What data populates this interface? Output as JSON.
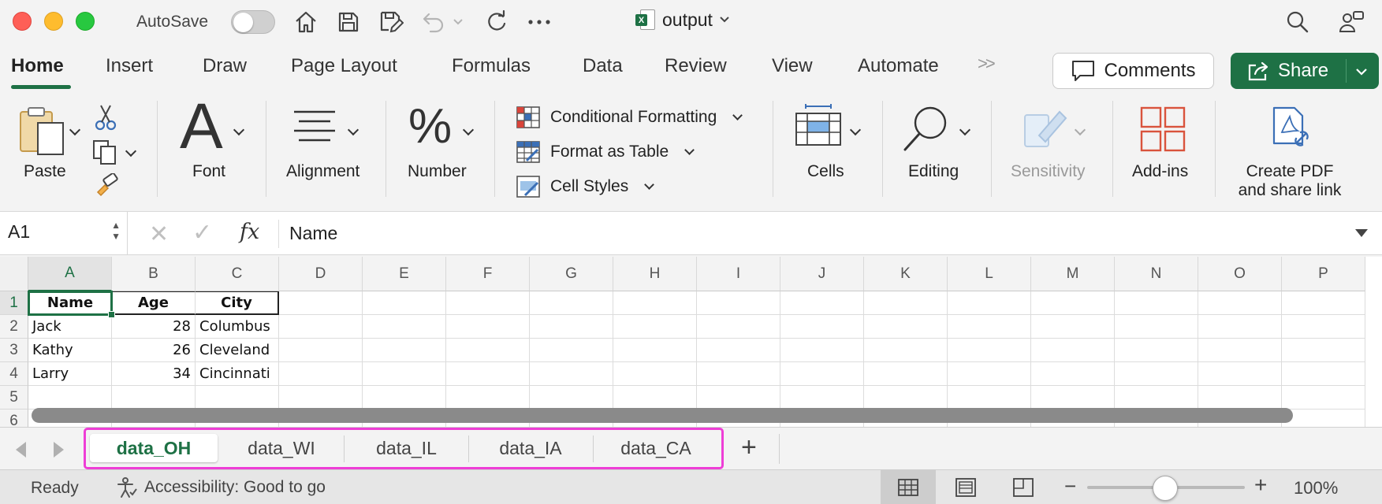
{
  "titlebar": {
    "autosave_label": "AutoSave",
    "autosave_on": false,
    "document_name": "output",
    "icons": [
      "home-icon",
      "save-icon",
      "save-as-icon",
      "undo-icon",
      "redo-icon",
      "more-icon",
      "search-icon",
      "share-people-icon"
    ]
  },
  "ribbon_tabs": {
    "items": [
      {
        "label": "Home",
        "active": true
      },
      {
        "label": "Insert"
      },
      {
        "label": "Draw"
      },
      {
        "label": "Page Layout"
      },
      {
        "label": "Formulas"
      },
      {
        "label": "Data"
      },
      {
        "label": "Review"
      },
      {
        "label": "View"
      },
      {
        "label": "Automate"
      }
    ],
    "more": ">>",
    "comments_label": "Comments",
    "share_label": "Share"
  },
  "ribbon": {
    "paste": "Paste",
    "font": "Font",
    "font_glyph": "A",
    "alignment": "Alignment",
    "number": "Number",
    "number_glyph": "%",
    "conditional_formatting": "Conditional Formatting",
    "format_as_table": "Format as Table",
    "cell_styles": "Cell Styles",
    "cells": "Cells",
    "editing": "Editing",
    "sensitivity": "Sensitivity",
    "addins": "Add-ins",
    "create_pdf_line1": "Create PDF",
    "create_pdf_line2": "and share link"
  },
  "formula_bar": {
    "name_box": "A1",
    "fx": "fx",
    "content": "Name"
  },
  "grid": {
    "columns": [
      "A",
      "B",
      "C",
      "D",
      "E",
      "F",
      "G",
      "H",
      "I",
      "J",
      "K",
      "L",
      "M",
      "N",
      "O",
      "P"
    ],
    "rows": [
      "1",
      "2",
      "3",
      "4",
      "5",
      "6"
    ],
    "selected_cell": "A1",
    "cells": {
      "A1": "Name",
      "B1": "Age",
      "C1": "City",
      "A2": "Jack",
      "B2": "28",
      "C2": "Columbus",
      "A3": "Kathy",
      "B3": "26",
      "C3": "Cleveland",
      "A4": "Larry",
      "B4": "34",
      "C4": "Cincinnati"
    }
  },
  "sheets": {
    "tabs": [
      "data_OH",
      "data_WI",
      "data_IL",
      "data_IA",
      "data_CA"
    ],
    "active": "data_OH",
    "add_label": "+",
    "highlight_color": "#ee3ed6"
  },
  "status": {
    "ready": "Ready",
    "accessibility": "Accessibility: Good to go",
    "zoom": "100%",
    "zoom_fraction": 0.5
  },
  "colors": {
    "accent": "#1e7145",
    "traffic_red": "#fe5f57",
    "traffic_yellow": "#febc2e",
    "traffic_green": "#28c840"
  }
}
